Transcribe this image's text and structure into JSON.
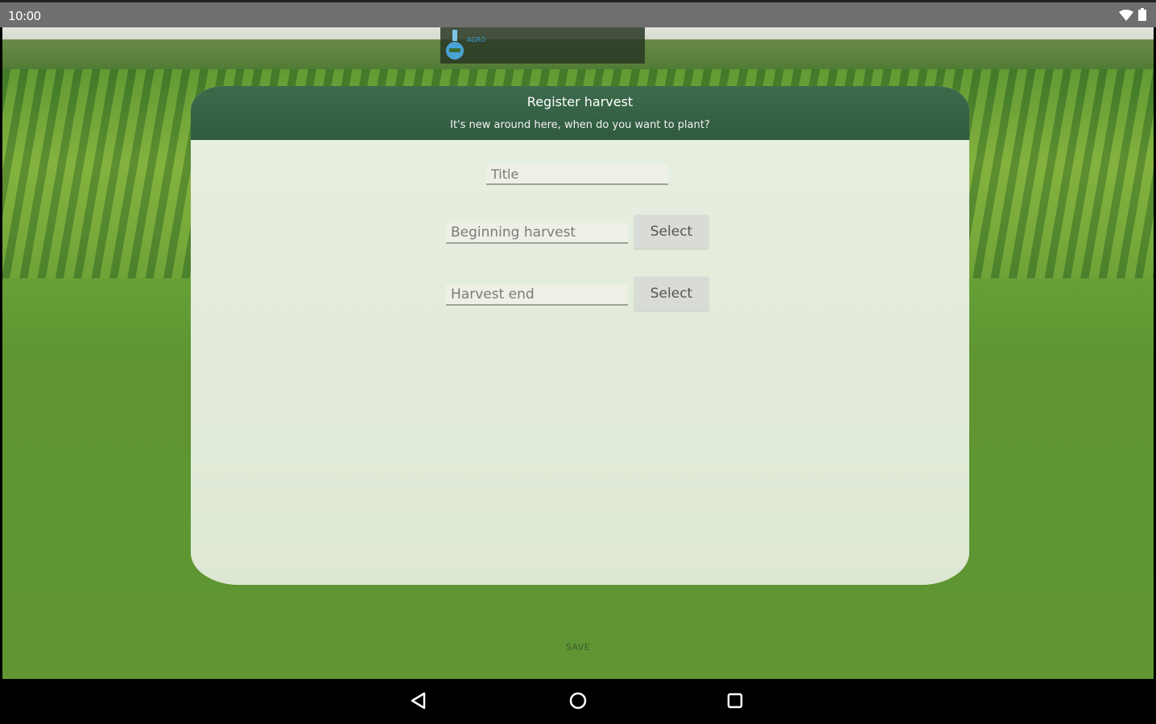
{
  "status_bar": {
    "time": "10:00",
    "icons": [
      "wifi-icon",
      "battery-icon"
    ]
  },
  "logo": {
    "icon": "flask-icon",
    "text": "AGRO"
  },
  "card": {
    "title": "Register harvest",
    "subtitle": "It's new around here, when do you want to plant?"
  },
  "form": {
    "title_placeholder": "Title",
    "begin_placeholder": "Beginning harvest",
    "end_placeholder": "Harvest end",
    "select_label_1": "Select",
    "select_label_2": "Select"
  },
  "actions": {
    "save_label": "SAVE"
  },
  "nav_bar": {
    "icons": [
      "back-icon",
      "home-icon",
      "recents-icon"
    ]
  },
  "colors": {
    "header": "#2f5a3e",
    "card": "#dfe8d5",
    "field": "#5e9532"
  }
}
